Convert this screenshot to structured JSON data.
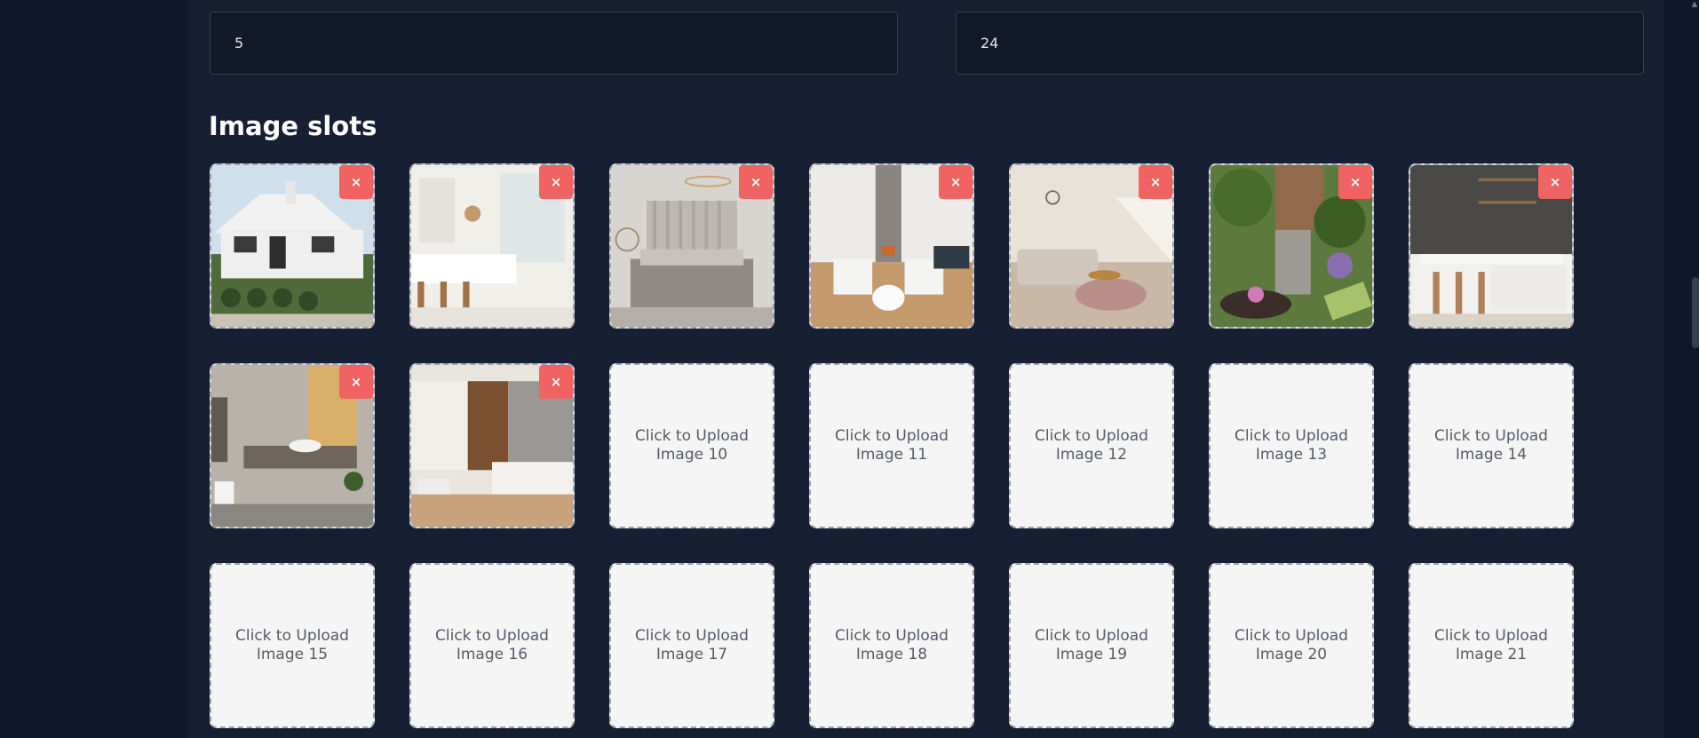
{
  "inputs": {
    "first_value": "5",
    "second_value": "24"
  },
  "section": {
    "title": "Image slots"
  },
  "slots": [
    {
      "remove_label": "×"
    },
    {
      "remove_label": "×"
    },
    {
      "remove_label": "×"
    },
    {
      "remove_label": "×"
    },
    {
      "remove_label": "×"
    },
    {
      "remove_label": "×"
    },
    {
      "remove_label": "×"
    },
    {
      "remove_label": "×"
    },
    {
      "remove_label": "×"
    },
    {
      "upload_label": "Click to Upload\nImage 10"
    },
    {
      "upload_label": "Click to Upload\nImage 11"
    },
    {
      "upload_label": "Click to Upload\nImage 12"
    },
    {
      "upload_label": "Click to Upload\nImage 13"
    },
    {
      "upload_label": "Click to Upload\nImage 14"
    },
    {
      "upload_label": "Click to Upload\nImage 15"
    },
    {
      "upload_label": "Click to Upload\nImage 16"
    },
    {
      "upload_label": "Click to Upload\nImage 17"
    },
    {
      "upload_label": "Click to Upload\nImage 18"
    },
    {
      "upload_label": "Click to Upload\nImage 19"
    },
    {
      "upload_label": "Click to Upload\nImage 20"
    },
    {
      "upload_label": "Click to Upload\nImage 21"
    }
  ],
  "colors": {
    "page_bg": "#0f172a",
    "panel_bg": "#172033",
    "remove_button": "#f16262",
    "empty_slot_bg": "#f5f5f5"
  }
}
